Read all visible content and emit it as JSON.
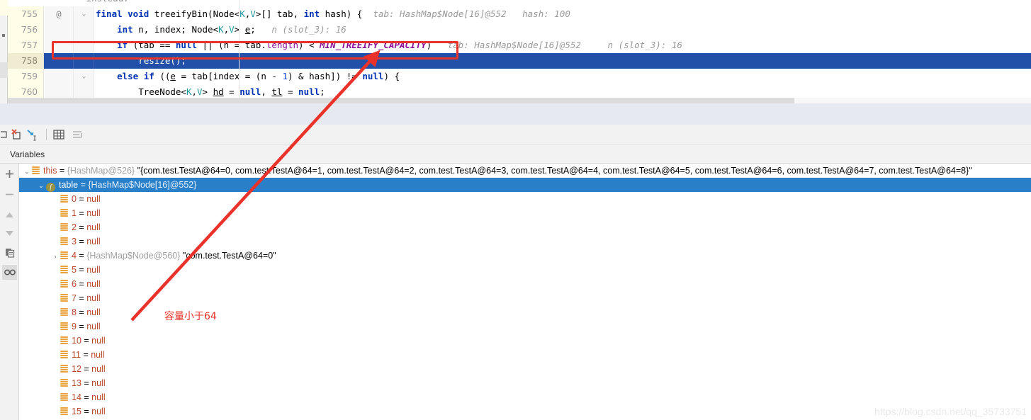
{
  "editor": {
    "partial_top_comment": "instead.",
    "lines": [
      {
        "num": "755",
        "ann": "@",
        "fold": "⌄",
        "highlight": false,
        "tokens": [
          {
            "t": "final ",
            "c": "kw"
          },
          {
            "t": "void ",
            "c": "kw"
          },
          {
            "t": "treeifyBin(",
            "c": ""
          },
          {
            "t": "Node",
            "c": ""
          },
          {
            "t": "<",
            "c": ""
          },
          {
            "t": "K",
            "c": "typ"
          },
          {
            "t": ",",
            "c": ""
          },
          {
            "t": "V",
            "c": "typ"
          },
          {
            "t": ">[] tab, ",
            "c": ""
          },
          {
            "t": "int ",
            "c": "kw"
          },
          {
            "t": "hash) {",
            "c": ""
          }
        ],
        "hints": "  tab: HashMap$Node[16]@552   hash: 100"
      },
      {
        "num": "756",
        "ann": "",
        "fold": "",
        "highlight": false,
        "tokens": [
          {
            "t": "    ",
            "c": ""
          },
          {
            "t": "int ",
            "c": "kw"
          },
          {
            "t": "n, index; Node<",
            "c": ""
          },
          {
            "t": "K",
            "c": "typ"
          },
          {
            "t": ",",
            "c": ""
          },
          {
            "t": "V",
            "c": "typ"
          },
          {
            "t": "> ",
            "c": ""
          },
          {
            "t": "e",
            "c": "ul"
          },
          {
            "t": ";",
            "c": ""
          }
        ],
        "hints": "   n (slot_3): 16"
      },
      {
        "num": "757",
        "ann": "",
        "fold": "",
        "highlight": false,
        "tokens": [
          {
            "t": "    ",
            "c": ""
          },
          {
            "t": "if ",
            "c": "kw"
          },
          {
            "t": "(tab == ",
            "c": ""
          },
          {
            "t": "null ",
            "c": "kw"
          },
          {
            "t": "|| ",
            "c": ""
          },
          {
            "t": "(n = tab.",
            "c": ""
          },
          {
            "t": "length",
            "c": "fld"
          },
          {
            "t": ") < ",
            "c": ""
          },
          {
            "t": "MIN_TREEIFY_CAPACITY",
            "c": "cst"
          },
          {
            "t": ")",
            "c": ""
          }
        ],
        "hints": "   tab: HashMap$Node[16]@552     n (slot_3): 16"
      },
      {
        "num": "758",
        "ann": "",
        "fold": "",
        "highlight": true,
        "tokens": [
          {
            "t": "        resize();",
            "c": ""
          }
        ],
        "hints": ""
      },
      {
        "num": "759",
        "ann": "",
        "fold": "⌄",
        "highlight": false,
        "tokens": [
          {
            "t": "    ",
            "c": ""
          },
          {
            "t": "else ",
            "c": "kw"
          },
          {
            "t": "if ",
            "c": "kw"
          },
          {
            "t": "((",
            "c": ""
          },
          {
            "t": "e",
            "c": "ul"
          },
          {
            "t": " = tab[index = (n - ",
            "c": ""
          },
          {
            "t": "1",
            "c": "num"
          },
          {
            "t": ") & hash]) != ",
            "c": ""
          },
          {
            "t": "null",
            "c": "kw"
          },
          {
            "t": ") {",
            "c": ""
          }
        ],
        "hints": ""
      },
      {
        "num": "760",
        "ann": "",
        "fold": "",
        "highlight": false,
        "tokens": [
          {
            "t": "        TreeNode<",
            "c": ""
          },
          {
            "t": "K",
            "c": "typ"
          },
          {
            "t": ",",
            "c": ""
          },
          {
            "t": "V",
            "c": "typ"
          },
          {
            "t": "> ",
            "c": ""
          },
          {
            "t": "hd",
            "c": "ul"
          },
          {
            "t": " = ",
            "c": ""
          },
          {
            "t": "null",
            "c": "kw"
          },
          {
            "t": ", ",
            "c": ""
          },
          {
            "t": "tl",
            "c": "ul"
          },
          {
            "t": " = ",
            "c": ""
          },
          {
            "t": "null",
            "c": "kw"
          },
          {
            "t": ";",
            "c": ""
          }
        ],
        "hints": ""
      }
    ]
  },
  "toolbar": {
    "icons": [
      {
        "name": "mute-breakpoints-icon",
        "glyph": "⌐"
      },
      {
        "name": "evaluate-expression-x-icon",
        "glyph": "X"
      },
      {
        "name": "step-into-icon",
        "glyph": "↳"
      },
      {
        "name": "show-as-table-icon",
        "glyph": "▦"
      },
      {
        "name": "sort-values-icon",
        "glyph": "≢"
      }
    ]
  },
  "variables_panel": {
    "tab_label": "Variables",
    "gutter_buttons": [
      {
        "name": "add-watch-button",
        "glyph": "+"
      },
      {
        "name": "remove-watch-button",
        "glyph": "−"
      },
      {
        "name": "move-up-button",
        "glyph": "▲"
      },
      {
        "name": "move-down-button",
        "glyph": "▼"
      },
      {
        "name": "copy-value-button",
        "glyph": "❐"
      },
      {
        "name": "inspect-button",
        "glyph": "∞"
      }
    ],
    "rows": [
      {
        "indent": 0,
        "twisty": "⌄",
        "icon": "array",
        "selected": false,
        "name": "this",
        "ref": "{HashMap@526}",
        "value": "\"{com.test.TestA@64=0, com.test.TestA@64=1, com.test.TestA@64=2, com.test.TestA@64=3, com.test.TestA@64=4, com.test.TestA@64=5, com.test.TestA@64=6, com.test.TestA@64=7, com.test.TestA@64=8}\""
      },
      {
        "indent": 1,
        "twisty": "⌄",
        "icon": "field",
        "selected": true,
        "name": "table",
        "ref": "{HashMap$Node[16]@552}",
        "value": ""
      },
      {
        "indent": 2,
        "twisty": "",
        "icon": "array",
        "selected": false,
        "name": "0",
        "ref": "",
        "value": "null",
        "is_null": true
      },
      {
        "indent": 2,
        "twisty": "",
        "icon": "array",
        "selected": false,
        "name": "1",
        "ref": "",
        "value": "null",
        "is_null": true
      },
      {
        "indent": 2,
        "twisty": "",
        "icon": "array",
        "selected": false,
        "name": "2",
        "ref": "",
        "value": "null",
        "is_null": true
      },
      {
        "indent": 2,
        "twisty": "",
        "icon": "array",
        "selected": false,
        "name": "3",
        "ref": "",
        "value": "null",
        "is_null": true
      },
      {
        "indent": 2,
        "twisty": "›",
        "icon": "array",
        "selected": false,
        "name": "4",
        "ref": "{HashMap$Node@560}",
        "value": "\"com.test.TestA@64=0\""
      },
      {
        "indent": 2,
        "twisty": "",
        "icon": "array",
        "selected": false,
        "name": "5",
        "ref": "",
        "value": "null",
        "is_null": true
      },
      {
        "indent": 2,
        "twisty": "",
        "icon": "array",
        "selected": false,
        "name": "6",
        "ref": "",
        "value": "null",
        "is_null": true
      },
      {
        "indent": 2,
        "twisty": "",
        "icon": "array",
        "selected": false,
        "name": "7",
        "ref": "",
        "value": "null",
        "is_null": true
      },
      {
        "indent": 2,
        "twisty": "",
        "icon": "array",
        "selected": false,
        "name": "8",
        "ref": "",
        "value": "null",
        "is_null": true
      },
      {
        "indent": 2,
        "twisty": "",
        "icon": "array",
        "selected": false,
        "name": "9",
        "ref": "",
        "value": "null",
        "is_null": true
      },
      {
        "indent": 2,
        "twisty": "",
        "icon": "array",
        "selected": false,
        "name": "10",
        "ref": "",
        "value": "null",
        "is_null": true
      },
      {
        "indent": 2,
        "twisty": "",
        "icon": "array",
        "selected": false,
        "name": "11",
        "ref": "",
        "value": "null",
        "is_null": true
      },
      {
        "indent": 2,
        "twisty": "",
        "icon": "array",
        "selected": false,
        "name": "12",
        "ref": "",
        "value": "null",
        "is_null": true
      },
      {
        "indent": 2,
        "twisty": "",
        "icon": "array",
        "selected": false,
        "name": "13",
        "ref": "",
        "value": "null",
        "is_null": true
      },
      {
        "indent": 2,
        "twisty": "",
        "icon": "array",
        "selected": false,
        "name": "14",
        "ref": "",
        "value": "null",
        "is_null": true
      },
      {
        "indent": 2,
        "twisty": "",
        "icon": "array",
        "selected": false,
        "name": "15",
        "ref": "",
        "value": "null",
        "is_null": true
      }
    ]
  },
  "annotations": {
    "note_text": "容量小于64",
    "note_color": "#e8322a",
    "box_color": "#e8322a",
    "arrow_color": "#e8322a"
  },
  "watermark": {
    "text": "https://blog.csdn.net/qq_35733751"
  }
}
